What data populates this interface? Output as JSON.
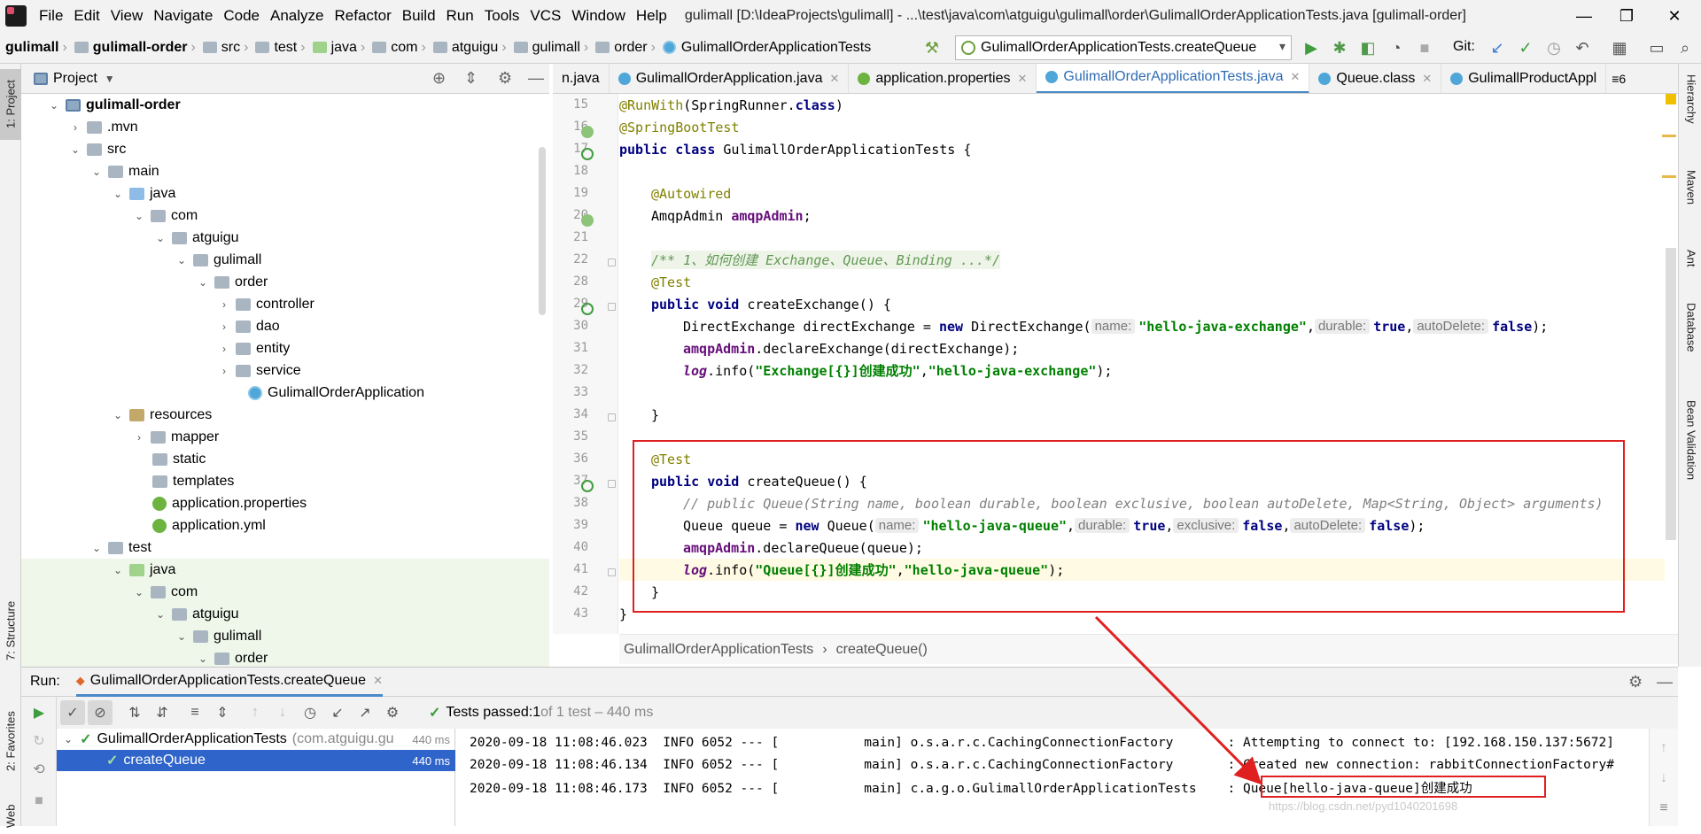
{
  "window": {
    "title": "gulimall [D:\\IdeaProjects\\gulimall] - ...\\test\\java\\com\\atguigu\\gulimall\\order\\GulimallOrderApplicationTests.java [gulimall-order]",
    "minimize": "—",
    "maximize": "❐",
    "close": "✕"
  },
  "menu": [
    "File",
    "Edit",
    "View",
    "Navigate",
    "Code",
    "Analyze",
    "Refactor",
    "Build",
    "Run",
    "Tools",
    "VCS",
    "Window",
    "Help"
  ],
  "navbar": {
    "crumbs": [
      "gulimall",
      "gulimall-order",
      "src",
      "test",
      "java",
      "com",
      "atguigu",
      "gulimall",
      "order",
      "GulimallOrderApplicationTests"
    ],
    "run_config": "GulimallOrderApplicationTests.createQueue",
    "git_label": "Git:"
  },
  "left_stripe": {
    "project_tab": "1: Project",
    "structure_tab": "7: Structure",
    "favorites_tab": "2: Favorites",
    "web_tab": "Web"
  },
  "right_stripe": {
    "tabs": [
      "Hierarchy",
      "Maven",
      "Ant",
      "Database",
      "Bean Validation"
    ]
  },
  "project": {
    "header": "Project",
    "tree": [
      {
        "label": "gulimall-order",
        "bold": true
      },
      {
        "label": ".mvn"
      },
      {
        "label": "src"
      },
      {
        "label": "main"
      },
      {
        "label": "java"
      },
      {
        "label": "com"
      },
      {
        "label": "atguigu"
      },
      {
        "label": "gulimall"
      },
      {
        "label": "order"
      },
      {
        "label": "controller"
      },
      {
        "label": "dao"
      },
      {
        "label": "entity"
      },
      {
        "label": "service"
      },
      {
        "label": "GulimallOrderApplication"
      },
      {
        "label": "resources"
      },
      {
        "label": "mapper"
      },
      {
        "label": "static"
      },
      {
        "label": "templates"
      },
      {
        "label": "application.properties"
      },
      {
        "label": "application.yml"
      },
      {
        "label": "test"
      },
      {
        "label": "java"
      },
      {
        "label": "com"
      },
      {
        "label": "atguigu"
      },
      {
        "label": "gulimall"
      },
      {
        "label": "order"
      }
    ]
  },
  "editor": {
    "tabs": [
      {
        "label": "n.java"
      },
      {
        "label": "GulimallOrderApplication.java"
      },
      {
        "label": "application.properties"
      },
      {
        "label": "GulimallOrderApplicationTests.java",
        "active": true
      },
      {
        "label": "Queue.class"
      },
      {
        "label": "GulimallProductAppl"
      }
    ],
    "tab_overflow": "≡6",
    "line_numbers": [
      "15",
      "16",
      "17",
      "18",
      "19",
      "20",
      "21",
      "22",
      "28",
      "29",
      "30",
      "31",
      "32",
      "33",
      "34",
      "35",
      "36",
      "37",
      "38",
      "39",
      "40",
      "41",
      "42",
      "43"
    ],
    "code": {
      "l15a": "@RunWith",
      "l15b": "(SpringRunner.",
      "l15c": "class",
      "l15d": ")",
      "l16": "@SpringBootTest",
      "l17a": "public class ",
      "l17b": "GulimallOrderApplicationTests {",
      "l19": "@Autowired",
      "l20a": "AmqpAdmin ",
      "l20b": "amqpAdmin",
      "l20c": ";",
      "l22": "/** 1、如何创建 Exchange、Queue、Binding ...*/",
      "l28": "@Test",
      "l29a": "public void ",
      "l29b": "createExchange() {",
      "l30a": "DirectExchange directExchange = ",
      "l30b": "new ",
      "l30c": "DirectExchange(",
      "l30h1": "name:",
      "l30s1": "\"hello-java-exchange\"",
      "l30c2": ",",
      "l30h2": "durable:",
      "l30k2": "true",
      "l30c3": ",",
      "l30h3": "autoDelete:",
      "l30k3": "false",
      "l30e": ");",
      "l31a": "amqpAdmin",
      "l31b": ".declareExchange(directExchange);",
      "l32a": "log",
      "l32b": ".info(",
      "l32s1": "\"Exchange[{}]创建成功\"",
      "l32c": ",",
      "l32s2": "\"hello-java-exchange\"",
      "l32e": ");",
      "l34": "}",
      "l36": "@Test",
      "l37a": "public void ",
      "l37b": "createQueue() {",
      "l38": "// public Queue(String name, boolean durable, boolean exclusive, boolean autoDelete, Map<String, Object> arguments)",
      "l39a": "Queue queue = ",
      "l39b": "new ",
      "l39c": "Queue(",
      "l39h1": "name:",
      "l39s1": "\"hello-java-queue\"",
      "l39c1": ",",
      "l39h2": "durable:",
      "l39k2": "true",
      "l39c2": ",",
      "l39h3": "exclusive:",
      "l39k3": "false",
      "l39c3": ",",
      "l39h4": "autoDelete:",
      "l39k4": "false",
      "l39e": ");",
      "l40a": "amqpAdmin",
      "l40b": ".declareQueue(queue);",
      "l41a": "log",
      "l41b": ".info(",
      "l41s1": "\"Queue[{}]创建成功\"",
      "l41c": ",",
      "l41s2": "\"hello-java-queue\"",
      "l41e": ");",
      "l42": "}",
      "l43": "}"
    },
    "breadcrumbs": [
      "GulimallOrderApplicationTests",
      "›",
      "createQueue()"
    ]
  },
  "run": {
    "label": "Run:",
    "tab": "GulimallOrderApplicationTests.createQueue",
    "status_prefix": "Tests passed: ",
    "status_count": "1",
    "status_suffix": " of 1 test – 440 ms",
    "tests": [
      {
        "name": "GulimallOrderApplicationTests",
        "pkg": "(com.atguigu.gu",
        "time": "440 ms"
      },
      {
        "name": "createQueue",
        "time": "440 ms"
      }
    ],
    "console": [
      "2020-09-18 11:08:46.023  INFO 6052 --- [           main] o.s.a.r.c.CachingConnectionFactory       : Attempting to connect to: [192.168.150.137:5672]",
      "2020-09-18 11:08:46.134  INFO 6052 --- [           main] o.s.a.r.c.CachingConnectionFactory       : Created new connection: rabbitConnectionFactory#",
      "2020-09-18 11:08:46.173  INFO 6052 --- [           main] c.a.g.o.GulimallOrderApplicationTests    : Queue[hello-java-queue]创建成功"
    ],
    "watermark": "https://blog.csdn.net/pyd1040201698"
  },
  "colors": {
    "accent": "#2f65ca",
    "highlight_box": "#e02020",
    "pass": "#3a9d3a"
  }
}
